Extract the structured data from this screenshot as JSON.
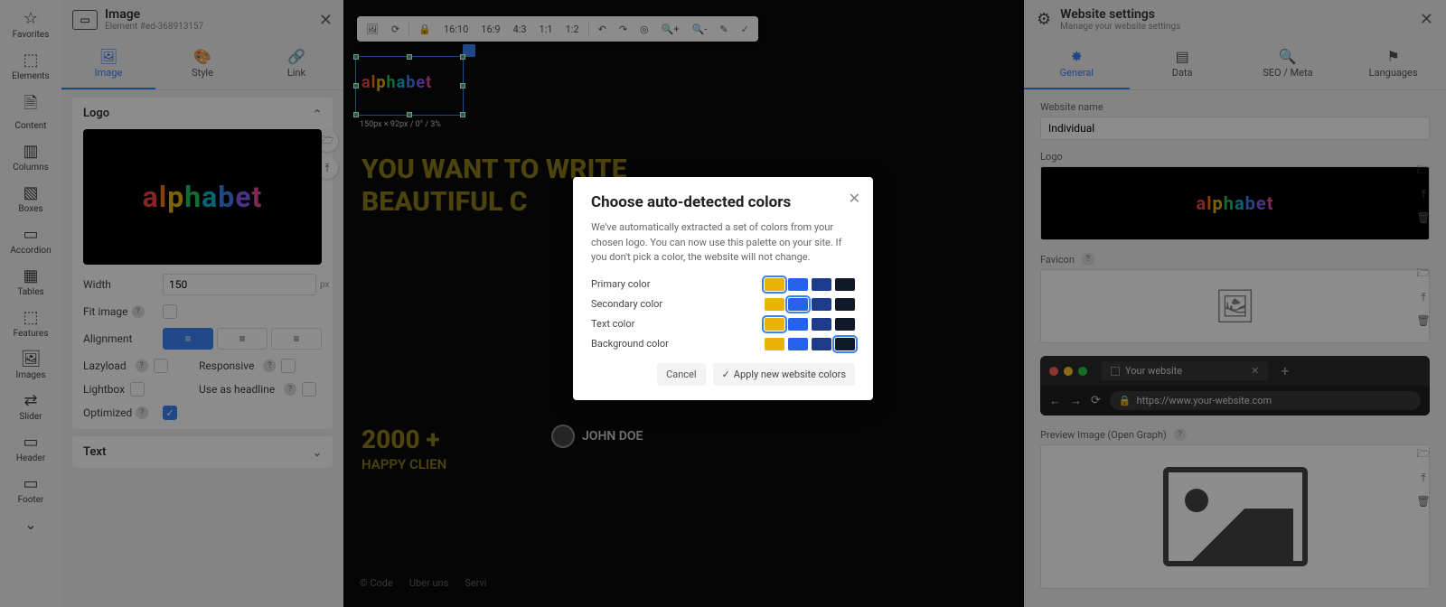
{
  "rail": {
    "items": [
      {
        "icon": "☆",
        "label": "Favorites"
      },
      {
        "icon": "⬚",
        "label": "Elements"
      },
      {
        "icon": "🗎",
        "label": "Content"
      },
      {
        "icon": "▥",
        "label": "Columns"
      },
      {
        "icon": "▧",
        "label": "Boxes"
      },
      {
        "icon": "▭",
        "label": "Accordion"
      },
      {
        "icon": "▦",
        "label": "Tables"
      },
      {
        "icon": "⬚",
        "label": "Features"
      },
      {
        "icon": "🖼",
        "label": "Images"
      },
      {
        "icon": "⇄",
        "label": "Slider"
      },
      {
        "icon": "▭",
        "label": "Header"
      },
      {
        "icon": "▭",
        "label": "Footer"
      }
    ]
  },
  "left_panel": {
    "title": "Image",
    "subtitle": "Element #ed-368913157",
    "tabs": [
      {
        "icon": "🖼",
        "label": "Image"
      },
      {
        "icon": "🎨",
        "label": "Style"
      },
      {
        "icon": "🔗",
        "label": "Link"
      }
    ],
    "section_logo": "Logo",
    "width_label": "Width",
    "width_value": "150",
    "width_unit": "px",
    "fit_label": "Fit image",
    "align_label": "Alignment",
    "lazy_label": "Lazyload",
    "responsive_label": "Responsive",
    "lightbox_label": "Lightbox",
    "headline_label": "Use as headline",
    "optimized_label": "Optimized",
    "section_text": "Text"
  },
  "toolbar": {
    "ratios": [
      "16:10",
      "16:9",
      "4:3",
      "1:1",
      "1:2"
    ]
  },
  "canvas": {
    "headline_l1": "YOU WANT TO WRITE",
    "headline_l2": "BEAUTIFUL C",
    "stat_value": "2000 +",
    "stat_label": "HAPPY CLIEN",
    "author": "JOHN DOE",
    "selected_dims": "150px × 92px / 0° / 3%",
    "footer_nav": [
      "© Code",
      "Uber uns",
      "Servi"
    ]
  },
  "right_panel": {
    "title": "Website settings",
    "subtitle": "Manage your website settings",
    "tabs": [
      {
        "icon": "✸",
        "label": "General"
      },
      {
        "icon": "▤",
        "label": "Data"
      },
      {
        "icon": "🔍",
        "label": "SEO / Meta"
      },
      {
        "icon": "⚑",
        "label": "Languages"
      }
    ],
    "website_name_label": "Website name",
    "website_name_value": "Individual",
    "logo_label": "Logo",
    "favicon_label": "Favicon",
    "browser_tab": "Your website",
    "browser_url": "https://www.your-website.com",
    "preview_label": "Preview Image (Open Graph)"
  },
  "modal": {
    "title": "Choose auto-detected colors",
    "desc": "We've automatically extracted a set of colors from your chosen logo. You can now use this palette on your site. If you don't pick a color, the website will not change.",
    "rows": [
      {
        "label": "Primary color",
        "colors": [
          "#eab308",
          "#2563eb",
          "#1e3a8a",
          "#111827"
        ],
        "selected": 0
      },
      {
        "label": "Secondary color",
        "colors": [
          "#eab308",
          "#2563eb",
          "#1e3a8a",
          "#111827"
        ],
        "selected": 1
      },
      {
        "label": "Text color",
        "colors": [
          "#eab308",
          "#2563eb",
          "#1e3a8a",
          "#111827"
        ],
        "selected": 0
      },
      {
        "label": "Background color",
        "colors": [
          "#eab308",
          "#2563eb",
          "#1e3a8a",
          "#111827"
        ],
        "selected": 3
      }
    ],
    "cancel": "Cancel",
    "apply": "Apply new website colors"
  }
}
